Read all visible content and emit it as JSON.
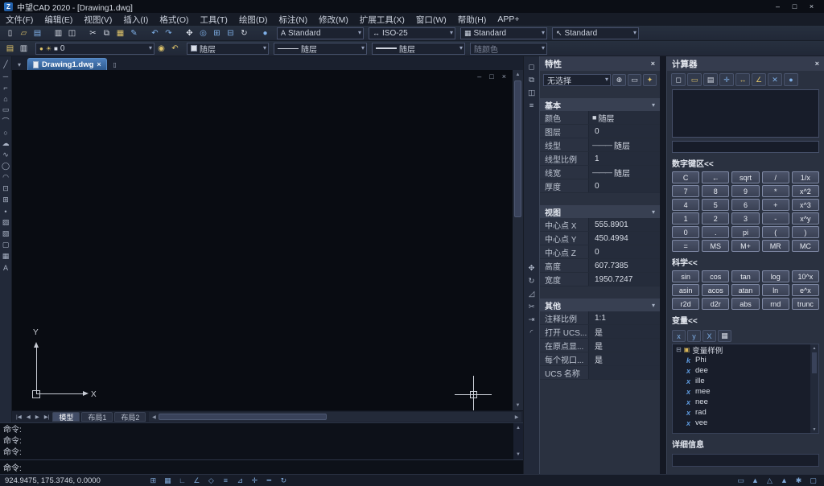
{
  "titlebar": {
    "title": "中望CAD 2020 - [Drawing1.dwg]"
  },
  "menu": {
    "items": [
      {
        "n": "menu-file",
        "label": "文件(F)"
      },
      {
        "n": "menu-edit",
        "label": "编辑(E)"
      },
      {
        "n": "menu-view",
        "label": "视图(V)"
      },
      {
        "n": "menu-insert",
        "label": "插入(I)"
      },
      {
        "n": "menu-format",
        "label": "格式(O)"
      },
      {
        "n": "menu-tools",
        "label": "工具(T)"
      },
      {
        "n": "menu-draw",
        "label": "绘图(D)"
      },
      {
        "n": "menu-dimension",
        "label": "标注(N)"
      },
      {
        "n": "menu-modify",
        "label": "修改(M)"
      },
      {
        "n": "menu-express-tools",
        "label": "扩展工具(X)"
      },
      {
        "n": "menu-window",
        "label": "窗口(W)"
      },
      {
        "n": "menu-help",
        "label": "帮助(H)"
      },
      {
        "n": "menu-app",
        "label": "APP+"
      }
    ]
  },
  "toolbar_main": {
    "icons": [
      {
        "n": "new-file-icon",
        "g": "▯",
        "k": "w"
      },
      {
        "n": "open-file-icon",
        "g": "▱",
        "k": "y"
      },
      {
        "n": "save-icon",
        "g": "▤",
        "k": "b"
      },
      {
        "n": "plot-icon",
        "g": "▥",
        "k": "w ml"
      },
      {
        "n": "plot-preview-icon",
        "g": "◫",
        "k": "w"
      },
      {
        "n": "cut-icon",
        "g": "✂",
        "k": "w ml"
      },
      {
        "n": "copy-icon",
        "g": "⧉",
        "k": "w"
      },
      {
        "n": "paste-icon",
        "g": "▦",
        "k": "y"
      },
      {
        "n": "match-properties-icon",
        "g": "✎",
        "k": "b"
      },
      {
        "n": "undo-icon",
        "g": "↶",
        "k": "b ml"
      },
      {
        "n": "redo-icon",
        "g": "↷",
        "k": "b"
      },
      {
        "n": "pan-icon",
        "g": "✥",
        "k": "w ml"
      },
      {
        "n": "zoom-realtime-icon",
        "g": "◎",
        "k": "b"
      },
      {
        "n": "zoom-window-icon",
        "g": "⊞",
        "k": "b"
      },
      {
        "n": "zoom-previous-icon",
        "g": "⊟",
        "k": "b"
      },
      {
        "n": "regen-icon",
        "g": "↻",
        "k": "w"
      },
      {
        "n": "help-icon",
        "g": "●",
        "k": "b ml"
      }
    ],
    "styles": [
      {
        "n": "text-style-select",
        "icon": "A",
        "value": "Standard"
      },
      {
        "n": "dim-style-select",
        "icon": "↔",
        "value": "ISO-25"
      },
      {
        "n": "table-style-select",
        "icon": "▦",
        "value": "Standard"
      },
      {
        "n": "mleader-style-select",
        "icon": "↖",
        "value": "Standard"
      }
    ]
  },
  "toolbar_props": {
    "left_icons": [
      {
        "n": "layer-manager-icon",
        "g": "▤",
        "k": "y"
      },
      {
        "n": "layer-states-icon",
        "g": "▥",
        "k": "w"
      }
    ],
    "layer": {
      "icons": [
        {
          "n": "layer-on-icon",
          "g": "●",
          "k": "y"
        },
        {
          "n": "layer-thaw-icon",
          "g": "☀",
          "k": "y"
        },
        {
          "n": "layer-color-swatch",
          "g": "■",
          "k": "w"
        }
      ],
      "value": "0"
    },
    "mid_icons": [
      {
        "n": "make-layer-current-icon",
        "g": "◉",
        "k": "y"
      },
      {
        "n": "previous-layer-icon",
        "g": "↶",
        "k": "y"
      }
    ],
    "color_value": "随层",
    "linetype_value": "随层",
    "lineweight_value": "随层",
    "plotstyle_value": "随颜色"
  },
  "draw_toolbar": {
    "tools": [
      {
        "n": "line-tool-icon",
        "g": "╱"
      },
      {
        "n": "xline-tool-icon",
        "g": "─"
      },
      {
        "n": "polyline-tool-icon",
        "g": "⌐"
      },
      {
        "n": "polygon-tool-icon",
        "g": "⌂"
      },
      {
        "n": "rectangle-tool-icon",
        "g": "▭"
      },
      {
        "n": "arc-tool-icon",
        "g": "⌒"
      },
      {
        "n": "circle-tool-icon",
        "g": "○"
      },
      {
        "n": "revcloud-tool-icon",
        "g": "☁"
      },
      {
        "n": "spline-tool-icon",
        "g": "∿"
      },
      {
        "n": "ellipse-tool-icon",
        "g": "◯"
      },
      {
        "n": "ellipse-arc-tool-icon",
        "g": "◠"
      },
      {
        "n": "insert-block-tool-icon",
        "g": "⊡"
      },
      {
        "n": "make-block-tool-icon",
        "g": "⊞"
      },
      {
        "n": "point-tool-icon",
        "g": "•"
      },
      {
        "n": "hatch-tool-icon",
        "g": "▨"
      },
      {
        "n": "gradient-tool-icon",
        "g": "▧"
      },
      {
        "n": "region-tool-icon",
        "g": "▢"
      },
      {
        "n": "table-tool-icon",
        "g": "▦"
      },
      {
        "n": "mtext-tool-icon",
        "g": "A"
      }
    ]
  },
  "modify_strip": {
    "group1": [
      {
        "n": "erase-tool-icon",
        "g": "◻"
      },
      {
        "n": "copy-tool-icon",
        "g": "⧉"
      },
      {
        "n": "mirror-tool-icon",
        "g": "◫"
      },
      {
        "n": "offset-tool-icon",
        "g": "≡"
      }
    ],
    "group2": [
      {
        "n": "move-tool-icon",
        "g": "✥"
      },
      {
        "n": "rotate-tool-icon",
        "g": "↻"
      },
      {
        "n": "scale-tool-icon",
        "g": "◿"
      },
      {
        "n": "trim-tool-icon",
        "g": "✂"
      },
      {
        "n": "extend-tool-icon",
        "g": "⇥"
      },
      {
        "n": "fillet-tool-icon",
        "g": "◜"
      }
    ]
  },
  "document": {
    "tab_label": "Drawing1.dwg",
    "layout_nav": [
      {
        "n": "first-layout-icon",
        "g": "|◀"
      },
      {
        "n": "prev-layout-icon",
        "g": "◀"
      },
      {
        "n": "next-layout-icon",
        "g": "▶"
      },
      {
        "n": "last-layout-icon",
        "g": "▶|"
      }
    ],
    "layout_tabs": [
      {
        "n": "tab-model",
        "label": "模型",
        "k": "active"
      },
      {
        "n": "tab-layout1",
        "label": "布局1",
        "k": "t"
      },
      {
        "n": "tab-layout2",
        "label": "布局2",
        "k": "t"
      }
    ],
    "ucs": {
      "x_label": "X",
      "y_label": "Y"
    }
  },
  "command": {
    "history": [
      "命令:",
      "命令:",
      "命令:"
    ],
    "prompt": "命令:"
  },
  "statusbar": {
    "coords": "924.9475, 175.3746, 0.0000",
    "left_icons": [
      {
        "n": "snap-icon",
        "g": "⊞"
      },
      {
        "n": "grid-icon",
        "g": "▦"
      },
      {
        "n": "ortho-icon",
        "g": "∟"
      },
      {
        "n": "polar-icon",
        "g": "∠"
      },
      {
        "n": "osnap-icon",
        "g": "◇"
      },
      {
        "n": "otrack-icon",
        "g": "≡"
      },
      {
        "n": "ducs-icon",
        "g": "⊿"
      },
      {
        "n": "dyn-icon",
        "g": "✛"
      },
      {
        "n": "lineweight-display-icon",
        "g": "━"
      },
      {
        "n": "cycle-select-icon",
        "g": "↻"
      }
    ],
    "right_icons": [
      {
        "n": "model-paper-toggle-icon",
        "g": "▭"
      },
      {
        "n": "annotation-scale-icon",
        "g": "▲"
      },
      {
        "n": "annotation-visibility-icon",
        "g": "△"
      },
      {
        "n": "auto-annotation-icon",
        "g": "▲"
      },
      {
        "n": "workspace-icon",
        "g": "✱"
      },
      {
        "n": "fullscreen-icon",
        "g": "▢"
      }
    ]
  },
  "properties_panel": {
    "title": "特性",
    "selection": "无选择",
    "header_icons": [
      {
        "n": "pickadd-toggle-icon",
        "g": "⊕",
        "k": "w"
      },
      {
        "n": "select-objects-icon",
        "g": "▭",
        "k": "w"
      },
      {
        "n": "quick-select-icon",
        "g": "✦",
        "k": "y"
      }
    ],
    "sections": [
      {
        "title": "基本",
        "rows": [
          {
            "label": "颜色",
            "glyph": "■",
            "value": "随层"
          },
          {
            "label": "图层",
            "glyph": "",
            "value": "0"
          },
          {
            "label": "线型",
            "glyph": "———",
            "value": "随层"
          },
          {
            "label": "线型比例",
            "glyph": "",
            "value": "1"
          },
          {
            "label": "线宽",
            "glyph": "———",
            "value": "随层"
          },
          {
            "label": "厚度",
            "glyph": "",
            "value": "0"
          }
        ]
      },
      {
        "title": "视图",
        "rows": [
          {
            "label": "中心点 X",
            "glyph": "",
            "value": "555.8901"
          },
          {
            "label": "中心点 Y",
            "glyph": "",
            "value": "450.4994"
          },
          {
            "label": "中心点 Z",
            "glyph": "",
            "value": "0"
          },
          {
            "label": "高度",
            "glyph": "",
            "value": "607.7385"
          },
          {
            "label": "宽度",
            "glyph": "",
            "value": "1950.7247"
          }
        ]
      },
      {
        "title": "其他",
        "rows": [
          {
            "label": "注释比例",
            "glyph": "",
            "value": "1:1"
          },
          {
            "label": "打开 UCS...",
            "glyph": "",
            "value": "是"
          },
          {
            "label": "在原点显...",
            "glyph": "",
            "value": "是"
          },
          {
            "label": "每个视口...",
            "glyph": "",
            "value": "是"
          },
          {
            "label": "UCS 名称",
            "glyph": "",
            "value": ""
          }
        ]
      }
    ]
  },
  "calculator": {
    "title": "计算器",
    "toolbar_icons": [
      {
        "n": "clear-icon",
        "g": "◻",
        "k": "w"
      },
      {
        "n": "clear-history-icon",
        "g": "▭",
        "k": "y"
      },
      {
        "n": "paste-value-icon",
        "g": "▤",
        "k": "w"
      },
      {
        "n": "get-coordinates-icon",
        "g": "✛",
        "k": "b"
      },
      {
        "n": "distance-icon",
        "g": "↔",
        "k": "y"
      },
      {
        "n": "angle-icon",
        "g": "∠",
        "k": "y"
      },
      {
        "n": "intersection-icon",
        "g": "✕",
        "k": "b"
      },
      {
        "n": "calc-help-icon",
        "g": "●",
        "k": "b"
      }
    ],
    "keypad_title": "数字键区<<",
    "keys": [
      "C",
      "←",
      "sqrt",
      "/",
      "1/x",
      "7",
      "8",
      "9",
      "*",
      "x^2",
      "4",
      "5",
      "6",
      "+",
      "x^3",
      "1",
      "2",
      "3",
      "-",
      "x^y",
      "0",
      ".",
      "pi",
      "(",
      ")",
      "=",
      "MS",
      "M+",
      "MR",
      "MC"
    ],
    "sci_title": "科学<<",
    "sci_keys": [
      "sin",
      "cos",
      "tan",
      "log",
      "10^x",
      "asin",
      "acos",
      "atan",
      "ln",
      "e^x",
      "r2d",
      "d2r",
      "abs",
      "rnd",
      "trunc"
    ],
    "vars_title": "变量<<",
    "vars_toolbar": [
      {
        "n": "new-variable-icon",
        "g": "x",
        "k": "b"
      },
      {
        "n": "new-category-icon",
        "g": "y",
        "k": "b"
      },
      {
        "n": "edit-variable-icon",
        "g": "X",
        "k": "b"
      },
      {
        "n": "delete-variable-icon",
        "g": "▦",
        "k": "w"
      }
    ],
    "vars_root": "变量样例",
    "variables": [
      {
        "icon": "k",
        "name": "Phi"
      },
      {
        "icon": "x",
        "name": "dee"
      },
      {
        "icon": "x",
        "name": "ille"
      },
      {
        "icon": "x",
        "name": "mee"
      },
      {
        "icon": "x",
        "name": "nee"
      },
      {
        "icon": "x",
        "name": "rad"
      },
      {
        "icon": "x",
        "name": "vee"
      }
    ],
    "details_title": "详细信息"
  }
}
